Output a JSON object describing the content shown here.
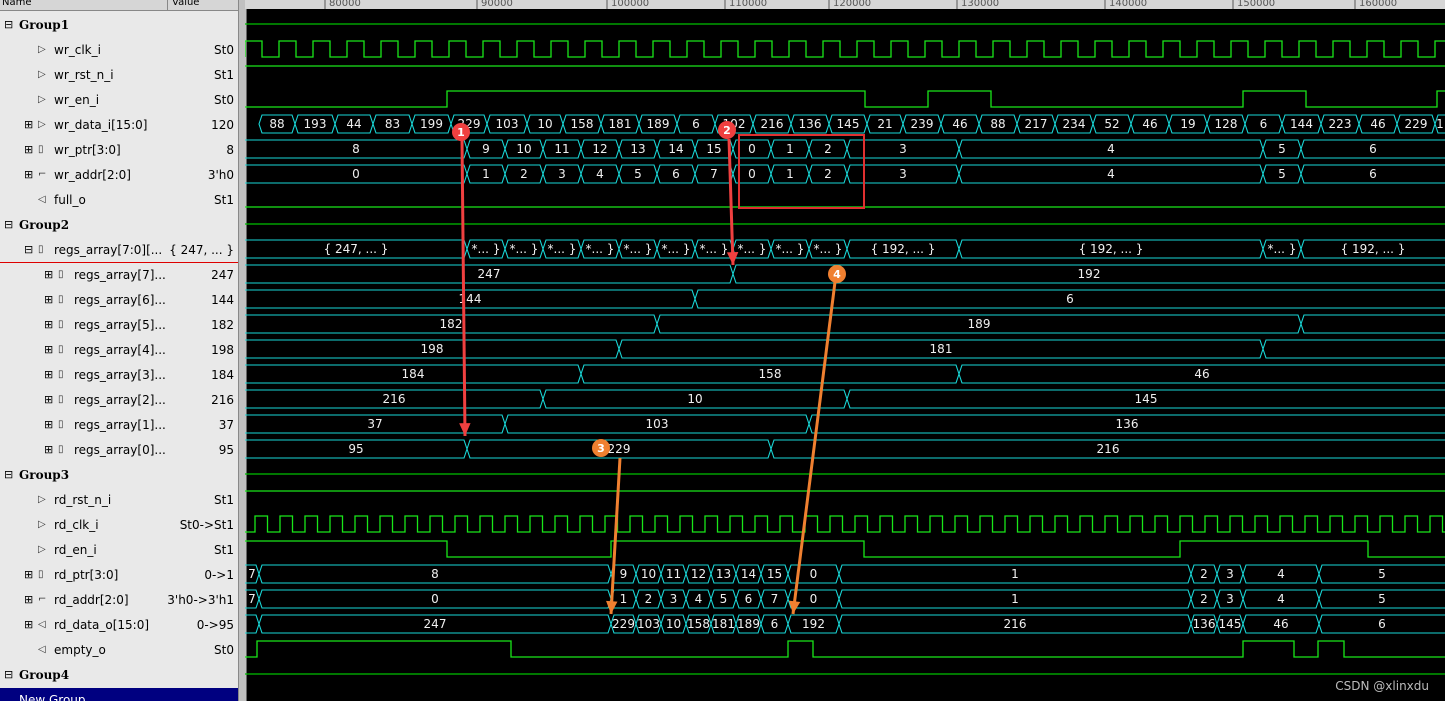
{
  "header": {
    "name_col": "Name",
    "value_col": "Value"
  },
  "timeline": {
    "ticks": [
      "80000",
      "90000",
      "100000",
      "110000",
      "120000",
      "130000",
      "140000",
      "150000",
      "160000"
    ]
  },
  "signals": [
    {
      "row": 0,
      "name": "Group1",
      "value": "",
      "group": true
    },
    {
      "row": 1,
      "name": "wr_clk_i",
      "value": "St0",
      "indent": 1,
      "icon": "input-port-icon"
    },
    {
      "row": 2,
      "name": "wr_rst_n_i",
      "value": "St1",
      "indent": 1,
      "icon": "input-port-icon"
    },
    {
      "row": 3,
      "name": "wr_en_i",
      "value": "St0",
      "indent": 1,
      "icon": "input-port-icon"
    },
    {
      "row": 4,
      "name": "wr_data_i[15:0]",
      "value": "120",
      "indent": 1,
      "icon": "input-bus-icon",
      "expand": true
    },
    {
      "row": 5,
      "name": "wr_ptr[3:0]",
      "value": "8",
      "indent": 1,
      "icon": "register-icon",
      "expand": true
    },
    {
      "row": 6,
      "name": "wr_addr[2:0]",
      "value": "3'h0",
      "indent": 1,
      "icon": "wire-icon",
      "expand": true
    },
    {
      "row": 7,
      "name": "full_o",
      "value": "St1",
      "indent": 1,
      "icon": "output-port-icon"
    },
    {
      "row": 8,
      "name": "Group2",
      "value": "",
      "group": true
    },
    {
      "row": 9,
      "name": "regs_array[7:0][...",
      "value": "{ 247, ... }",
      "indent": 1,
      "icon": "register-icon",
      "expand": true,
      "open": true
    },
    {
      "row": 10,
      "name": "regs_array[7]...",
      "value": "247",
      "indent": 2,
      "icon": "register-icon",
      "expand": true
    },
    {
      "row": 11,
      "name": "regs_array[6]...",
      "value": "144",
      "indent": 2,
      "icon": "register-icon",
      "expand": true
    },
    {
      "row": 12,
      "name": "regs_array[5]...",
      "value": "182",
      "indent": 2,
      "icon": "register-icon",
      "expand": true
    },
    {
      "row": 13,
      "name": "regs_array[4]...",
      "value": "198",
      "indent": 2,
      "icon": "register-icon",
      "expand": true
    },
    {
      "row": 14,
      "name": "regs_array[3]...",
      "value": "184",
      "indent": 2,
      "icon": "register-icon",
      "expand": true
    },
    {
      "row": 15,
      "name": "regs_array[2]...",
      "value": "216",
      "indent": 2,
      "icon": "register-icon",
      "expand": true
    },
    {
      "row": 16,
      "name": "regs_array[1]...",
      "value": "37",
      "indent": 2,
      "icon": "register-icon",
      "expand": true
    },
    {
      "row": 17,
      "name": "regs_array[0]...",
      "value": "95",
      "indent": 2,
      "icon": "register-icon",
      "expand": true
    },
    {
      "row": 18,
      "name": "Group3",
      "value": "",
      "group": true
    },
    {
      "row": 19,
      "name": "rd_rst_n_i",
      "value": "St1",
      "indent": 1,
      "icon": "input-port-icon"
    },
    {
      "row": 20,
      "name": "rd_clk_i",
      "value": "St0->St1",
      "indent": 1,
      "icon": "input-port-icon"
    },
    {
      "row": 21,
      "name": "rd_en_i",
      "value": "St1",
      "indent": 1,
      "icon": "input-port-icon"
    },
    {
      "row": 22,
      "name": "rd_ptr[3:0]",
      "value": "0->1",
      "indent": 1,
      "icon": "register-icon",
      "expand": true
    },
    {
      "row": 23,
      "name": "rd_addr[2:0]",
      "value": "3'h0->3'h1",
      "indent": 1,
      "icon": "wire-icon",
      "expand": true
    },
    {
      "row": 24,
      "name": "rd_data_o[15:0]",
      "value": "0->95",
      "indent": 1,
      "icon": "output-bus-icon",
      "expand": true
    },
    {
      "row": 25,
      "name": "empty_o",
      "value": "St0",
      "indent": 1,
      "icon": "output-port-icon"
    },
    {
      "row": 26,
      "name": "Group4",
      "value": "",
      "group": true
    },
    {
      "row": 27,
      "name": "New Group",
      "value": "",
      "newgroup": true
    }
  ],
  "waves": {
    "wr_clk": {
      "row": 1,
      "start": 0,
      "period": 34
    },
    "wr_en": {
      "row": 3,
      "points": [
        [
          0,
          0
        ],
        [
          202,
          0
        ],
        [
          202,
          1
        ],
        [
          620,
          1
        ],
        [
          620,
          0
        ],
        [
          683,
          0
        ],
        [
          683,
          1
        ],
        [
          746,
          1
        ],
        [
          746,
          0
        ],
        [
          998,
          0
        ],
        [
          998,
          1
        ],
        [
          1061,
          1
        ],
        [
          1061,
          0
        ],
        [
          1192,
          0
        ],
        [
          1192,
          1
        ],
        [
          1200,
          1
        ]
      ]
    },
    "wr_rst": {
      "row": 2,
      "level": 1
    },
    "full": {
      "row": 7,
      "level": 0
    },
    "rd_rst": {
      "row": 19,
      "level": 1
    },
    "rd_clk": {
      "row": 20,
      "start": 10,
      "period": 25
    },
    "rd_en": {
      "row": 21,
      "points": [
        [
          0,
          1
        ],
        [
          202,
          1
        ],
        [
          202,
          0
        ],
        [
          366,
          0
        ],
        [
          366,
          1
        ],
        [
          619,
          1
        ],
        [
          619,
          0
        ],
        [
          935,
          0
        ],
        [
          935,
          1
        ],
        [
          1123,
          1
        ],
        [
          1123,
          0
        ],
        [
          1200,
          0
        ]
      ]
    },
    "empty": {
      "row": 25,
      "points": [
        [
          0,
          0
        ],
        [
          12,
          0
        ],
        [
          12,
          1
        ],
        [
          266,
          1
        ],
        [
          266,
          0
        ],
        [
          543,
          0
        ],
        [
          543,
          1
        ],
        [
          568,
          1
        ],
        [
          568,
          0
        ],
        [
          998,
          0
        ],
        [
          998,
          1
        ],
        [
          1049,
          1
        ],
        [
          1049,
          0
        ],
        [
          1073,
          0
        ],
        [
          1073,
          1
        ],
        [
          1099,
          1
        ],
        [
          1099,
          0
        ],
        [
          1200,
          0
        ]
      ]
    },
    "group_lines": [
      0,
      8,
      18,
      26
    ]
  },
  "buses": [
    {
      "row": 4,
      "segs": [
        [
          14,
          "88"
        ],
        [
          50,
          "193"
        ],
        [
          90,
          "44"
        ],
        [
          128,
          "83"
        ],
        [
          167,
          "199"
        ],
        [
          206,
          "229"
        ],
        [
          242,
          "103"
        ],
        [
          282,
          "10"
        ],
        [
          318,
          "158"
        ],
        [
          356,
          "181"
        ],
        [
          394,
          "189"
        ],
        [
          432,
          "6"
        ],
        [
          470,
          "102"
        ],
        [
          508,
          "216"
        ],
        [
          546,
          "136"
        ],
        [
          584,
          "145"
        ],
        [
          622,
          "21"
        ],
        [
          658,
          "239"
        ],
        [
          696,
          "46"
        ],
        [
          734,
          "88"
        ],
        [
          772,
          "217"
        ],
        [
          810,
          "234"
        ],
        [
          848,
          "52"
        ],
        [
          886,
          "46"
        ],
        [
          924,
          "19"
        ],
        [
          962,
          "128"
        ],
        [
          1000,
          "6"
        ],
        [
          1037,
          "144"
        ],
        [
          1076,
          "223"
        ],
        [
          1114,
          "46"
        ],
        [
          1152,
          "229"
        ],
        [
          1190,
          "1"
        ]
      ]
    },
    {
      "row": 5,
      "segs": [
        [
          0,
          "8"
        ],
        [
          222,
          "9"
        ],
        [
          260,
          "10"
        ],
        [
          298,
          "11"
        ],
        [
          336,
          "12"
        ],
        [
          374,
          "13"
        ],
        [
          412,
          "14"
        ],
        [
          450,
          "15"
        ],
        [
          488,
          "0"
        ],
        [
          526,
          "1"
        ],
        [
          564,
          "2"
        ],
        [
          602,
          "3"
        ],
        [
          714,
          "4"
        ],
        [
          1018,
          "5"
        ],
        [
          1056,
          "6"
        ]
      ]
    },
    {
      "row": 6,
      "segs": [
        [
          0,
          "0"
        ],
        [
          222,
          "1"
        ],
        [
          260,
          "2"
        ],
        [
          298,
          "3"
        ],
        [
          336,
          "4"
        ],
        [
          374,
          "5"
        ],
        [
          412,
          "6"
        ],
        [
          450,
          "7"
        ],
        [
          488,
          "0"
        ],
        [
          526,
          "1"
        ],
        [
          564,
          "2"
        ],
        [
          602,
          "3"
        ],
        [
          714,
          "4"
        ],
        [
          1018,
          "5"
        ],
        [
          1056,
          "6"
        ]
      ]
    },
    {
      "row": 9,
      "segs": [
        [
          0,
          "{ 247, ... }"
        ],
        [
          222,
          "*... }"
        ],
        [
          260,
          "*... }"
        ],
        [
          298,
          "*... }"
        ],
        [
          336,
          "*... }"
        ],
        [
          374,
          "*... }"
        ],
        [
          412,
          "*... }"
        ],
        [
          450,
          "*... }"
        ],
        [
          488,
          "*... }"
        ],
        [
          526,
          "*... }"
        ],
        [
          564,
          "*... }"
        ],
        [
          602,
          "{ 192, ... }"
        ],
        [
          714,
          "{ 192, ... }"
        ],
        [
          1018,
          "*... }"
        ],
        [
          1056,
          "{ 192, ... }"
        ]
      ]
    },
    {
      "row": 10,
      "segs": [
        [
          0,
          "247"
        ],
        [
          488,
          "192"
        ]
      ]
    },
    {
      "row": 11,
      "segs": [
        [
          0,
          "144"
        ],
        [
          450,
          "6"
        ]
      ]
    },
    {
      "row": 12,
      "segs": [
        [
          0,
          "182"
        ],
        [
          412,
          "189"
        ],
        [
          1056,
          ""
        ]
      ]
    },
    {
      "row": 13,
      "segs": [
        [
          0,
          "198"
        ],
        [
          374,
          "181"
        ],
        [
          1018,
          ""
        ]
      ]
    },
    {
      "row": 14,
      "segs": [
        [
          0,
          "184"
        ],
        [
          336,
          "158"
        ],
        [
          714,
          "46"
        ]
      ]
    },
    {
      "row": 15,
      "segs": [
        [
          0,
          "216"
        ],
        [
          298,
          "10"
        ],
        [
          602,
          "145"
        ]
      ]
    },
    {
      "row": 16,
      "segs": [
        [
          0,
          "37"
        ],
        [
          260,
          "103"
        ],
        [
          564,
          "136"
        ]
      ]
    },
    {
      "row": 17,
      "segs": [
        [
          0,
          "95"
        ],
        [
          222,
          "229"
        ],
        [
          526,
          "216"
        ]
      ]
    },
    {
      "row": 22,
      "segs": [
        [
          0,
          "7"
        ],
        [
          14,
          "8"
        ],
        [
          366,
          "9"
        ],
        [
          391,
          "10"
        ],
        [
          416,
          "11"
        ],
        [
          441,
          "12"
        ],
        [
          466,
          "13"
        ],
        [
          491,
          "14"
        ],
        [
          516,
          "15"
        ],
        [
          543,
          "0"
        ],
        [
          594,
          "1"
        ],
        [
          946,
          "2"
        ],
        [
          972,
          "3"
        ],
        [
          998,
          "4"
        ],
        [
          1074,
          "5"
        ]
      ]
    },
    {
      "row": 23,
      "segs": [
        [
          0,
          "7"
        ],
        [
          14,
          "0"
        ],
        [
          366,
          "1"
        ],
        [
          391,
          "2"
        ],
        [
          416,
          "3"
        ],
        [
          441,
          "4"
        ],
        [
          466,
          "5"
        ],
        [
          491,
          "6"
        ],
        [
          516,
          "7"
        ],
        [
          543,
          "0"
        ],
        [
          594,
          "1"
        ],
        [
          946,
          "2"
        ],
        [
          972,
          "3"
        ],
        [
          998,
          "4"
        ],
        [
          1074,
          "5"
        ]
      ]
    },
    {
      "row": 24,
      "segs": [
        [
          0,
          ""
        ],
        [
          14,
          "247"
        ],
        [
          366,
          "229"
        ],
        [
          391,
          "103"
        ],
        [
          416,
          "10"
        ],
        [
          441,
          "158"
        ],
        [
          466,
          "181"
        ],
        [
          491,
          "189"
        ],
        [
          516,
          "6"
        ],
        [
          543,
          "192"
        ],
        [
          594,
          "216"
        ],
        [
          946,
          "136"
        ],
        [
          972,
          "145"
        ],
        [
          998,
          "46"
        ],
        [
          1074,
          "6"
        ]
      ]
    }
  ],
  "annotations": [
    {
      "num": "1",
      "color": "#f04040",
      "badge": [
        216,
        132
      ]
    },
    {
      "num": "2",
      "color": "#f04040",
      "badge": [
        482,
        130
      ]
    },
    {
      "num": "3",
      "color": "#f08030",
      "badge": [
        356,
        448
      ]
    },
    {
      "num": "4",
      "color": "#f08030",
      "badge": [
        592,
        274
      ]
    }
  ],
  "watermark": "CSDN @xlinxdu"
}
